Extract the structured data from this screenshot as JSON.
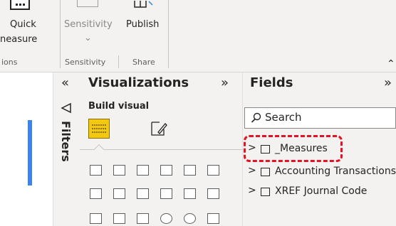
{
  "ribbon": {
    "quick_measure": {
      "line1": "Quick",
      "line2": "neasure"
    },
    "sensitivity": {
      "label": "Sensitivity",
      "chevron": "⌄"
    },
    "publish": {
      "label": "Publish"
    },
    "groups": {
      "calculations": "ions",
      "sensitivity": "Sensitivity",
      "share": "Share"
    },
    "collapse_icon": "⌃"
  },
  "filters": {
    "collapse_icon": "«",
    "label": "Filters"
  },
  "visualizations": {
    "title": "Visualizations",
    "expand_icon": "»",
    "build_visual_label": "Build visual"
  },
  "fields": {
    "title": "Fields",
    "expand_icon": "»",
    "search_placeholder": "Search",
    "tables": [
      {
        "name": "_Measures",
        "highlighted": true
      },
      {
        "name": "Accounting Transactions",
        "highlighted": false
      },
      {
        "name": "XREF Journal Code",
        "highlighted": false
      }
    ]
  },
  "colors": {
    "accent_highlight": "#e81123",
    "build_visual_icon": "#f2c811",
    "canvas_bar": "#3b82f6"
  }
}
